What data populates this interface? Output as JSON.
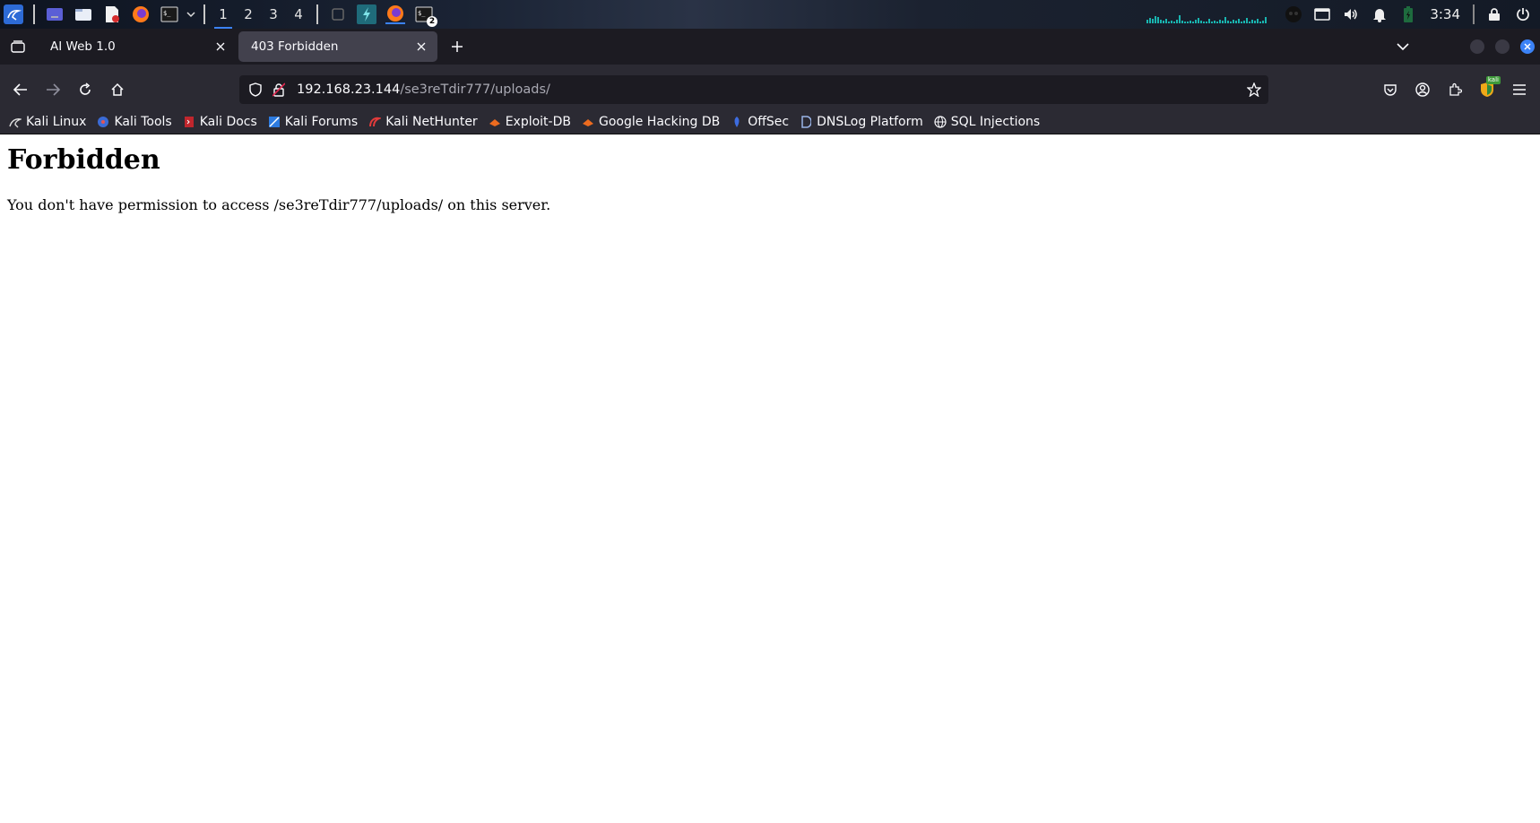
{
  "panel": {
    "workspaces": [
      "1",
      "2",
      "3",
      "4"
    ],
    "active_workspace": "1",
    "clock": "3:34",
    "terminal_badge": "2",
    "accent_color": "#3b82f6"
  },
  "tabs": [
    {
      "title": "AI Web 1.0",
      "active": false
    },
    {
      "title": "403 Forbidden",
      "active": true
    }
  ],
  "url": {
    "host": "192.168.23.144",
    "path": "/se3reTdir777/uploads/"
  },
  "extension_badge": "kali",
  "bookmarks": [
    {
      "label": "Kali Linux",
      "icon": "kali-dragon-icon"
    },
    {
      "label": "Kali Tools",
      "icon": "kali-tools-icon"
    },
    {
      "label": "Kali Docs",
      "icon": "kali-docs-icon"
    },
    {
      "label": "Kali Forums",
      "icon": "kali-forums-icon"
    },
    {
      "label": "Kali NetHunter",
      "icon": "nethunter-icon"
    },
    {
      "label": "Exploit-DB",
      "icon": "exploit-db-icon"
    },
    {
      "label": "Google Hacking DB",
      "icon": "ghdb-icon"
    },
    {
      "label": "OffSec",
      "icon": "offsec-icon"
    },
    {
      "label": "DNSLog Platform",
      "icon": "dnslog-icon"
    },
    {
      "label": "SQL Injections",
      "icon": "globe-icon"
    }
  ],
  "page": {
    "heading": "Forbidden",
    "message": "You don't have permission to access /se3reTdir777/uploads/ on this server."
  }
}
